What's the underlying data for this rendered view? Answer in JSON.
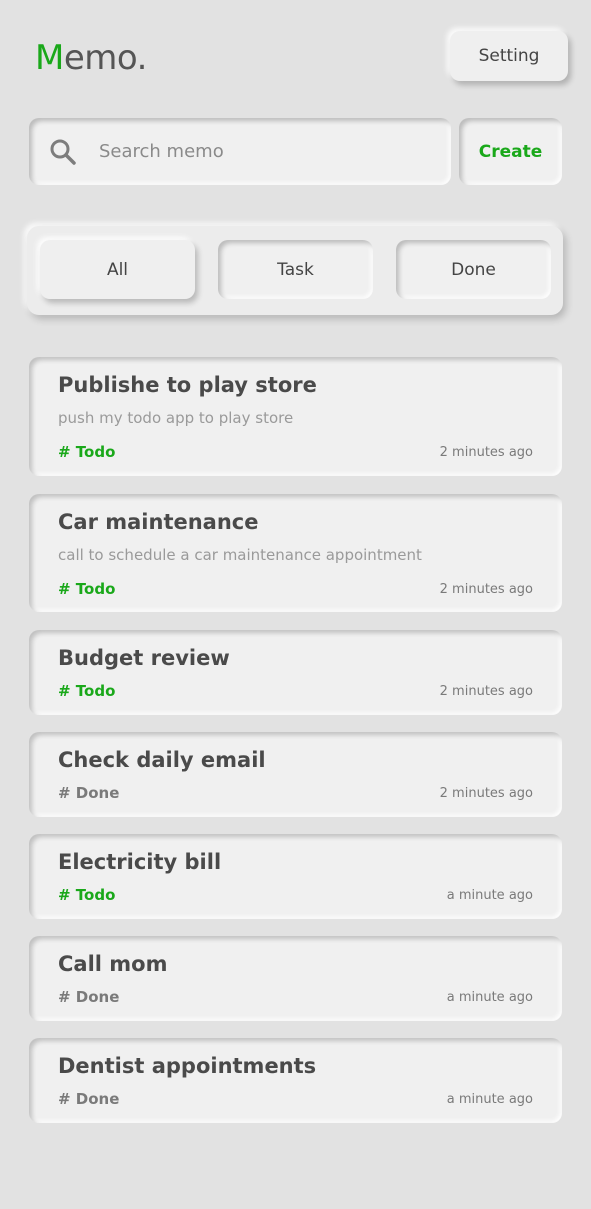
{
  "header": {
    "logo_first": "M",
    "logo_rest": "emo.",
    "setting_label": "Setting"
  },
  "search": {
    "placeholder": "Search memo",
    "create_label": "Create",
    "icon": "search-icon"
  },
  "filters": {
    "all": "All",
    "task": "Task",
    "done": "Done"
  },
  "colors": {
    "accent": "#1aa81a",
    "background": "#e2e2e2",
    "card": "#f0f0f0"
  },
  "memos": [
    {
      "title": "Publishe to play store",
      "description": "push my todo app to play store",
      "tag": "# Todo",
      "status": "todo",
      "time": "2 minutes ago"
    },
    {
      "title": "Car maintenance",
      "description": "call to schedule a car maintenance appointment",
      "tag": "# Todo",
      "status": "todo",
      "time": "2 minutes ago"
    },
    {
      "title": "Budget review",
      "description": "",
      "tag": "# Todo",
      "status": "todo",
      "time": "2 minutes ago"
    },
    {
      "title": "Check daily email",
      "description": "",
      "tag": "# Done",
      "status": "done",
      "time": "2 minutes ago"
    },
    {
      "title": "Electricity bill",
      "description": "",
      "tag": "# Todo",
      "status": "todo",
      "time": "a minute ago"
    },
    {
      "title": "Call mom",
      "description": "",
      "tag": "# Done",
      "status": "done",
      "time": "a minute ago"
    },
    {
      "title": "Dentist appointments",
      "description": "",
      "tag": "# Done",
      "status": "done",
      "time": "a minute ago"
    }
  ]
}
